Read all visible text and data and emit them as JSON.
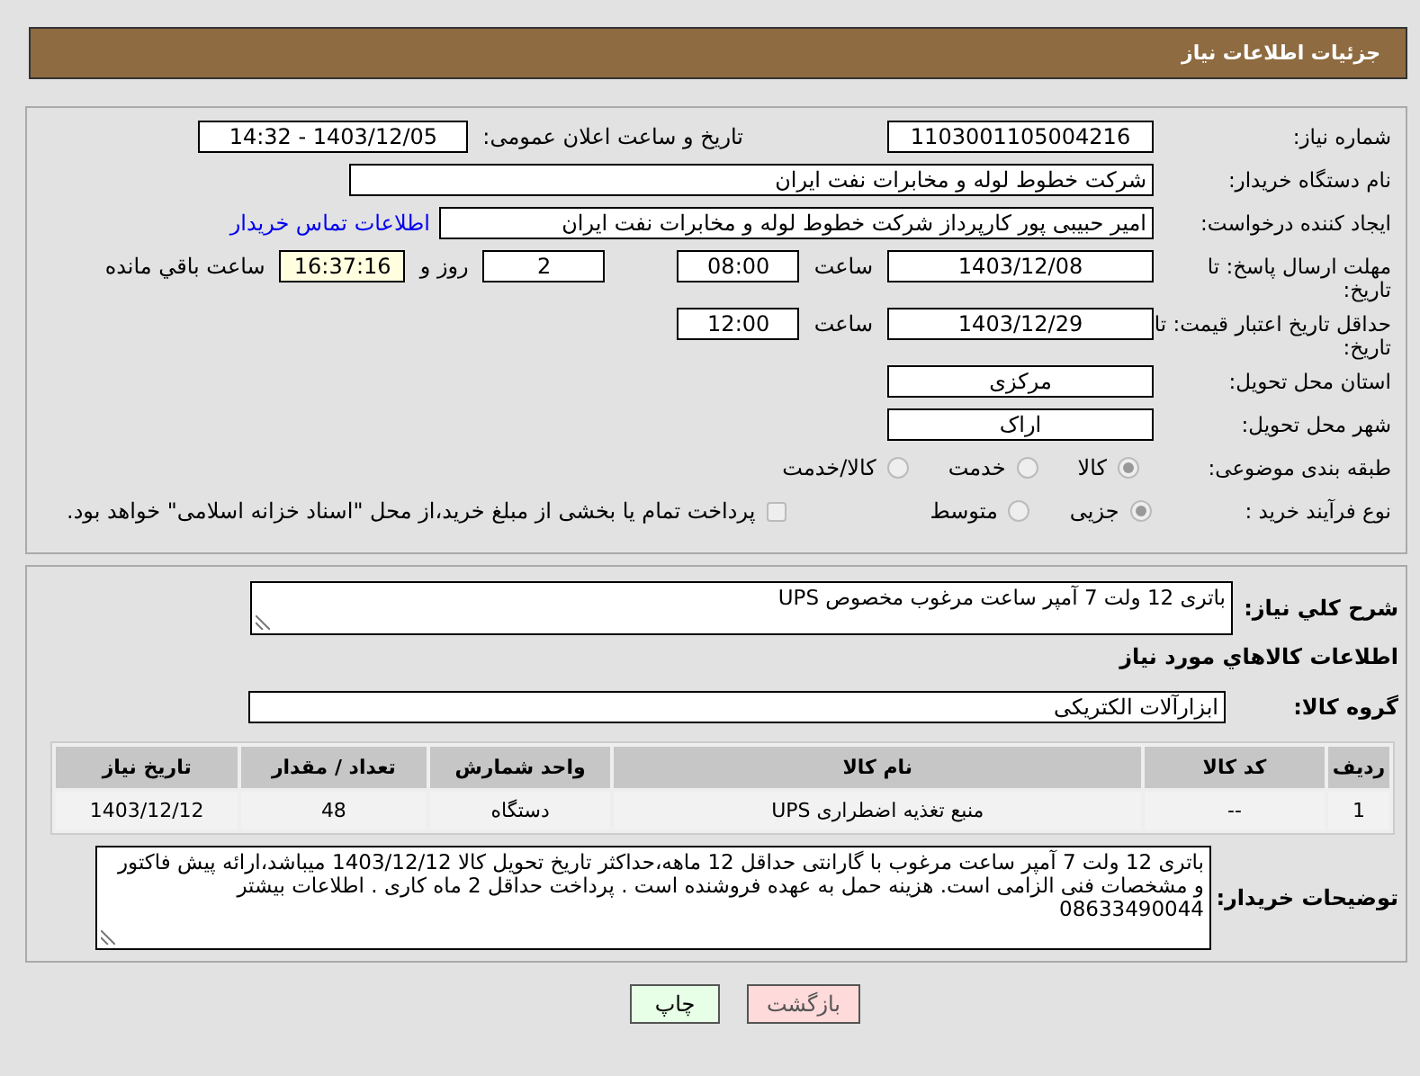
{
  "header": {
    "title": "جزئیات اطلاعات نیاز"
  },
  "details": [
    {
      "label": "شماره نیاز:",
      "parts": [
        {
          "kind": "field",
          "value": "1103001105004216"
        },
        {
          "kind": "text",
          "value": "تاریخ و ساعت اعلان عمومی:"
        },
        {
          "kind": "field",
          "value": "1403/12/05 - 14:32"
        }
      ]
    },
    {
      "label": "نام دستگاه خریدار:",
      "parts": [
        {
          "kind": "field",
          "value": "شرکت خطوط لوله و مخابرات نفت ایران"
        }
      ]
    },
    {
      "label": "ایجاد کننده درخواست:",
      "parts": [
        {
          "kind": "field",
          "value": "امیر  حبیبی پور  کارپرداز شرکت خطوط لوله و مخابرات نفت ایران"
        },
        {
          "kind": "link",
          "value": "اطلاعات تماس خریدار"
        }
      ]
    },
    {
      "label": "مهلت ارسال پاسخ: تا تاریخ:",
      "parts": [
        {
          "kind": "field",
          "value": "1403/12/08"
        },
        {
          "kind": "text",
          "value": "ساعت"
        },
        {
          "kind": "field",
          "value": "08:00"
        },
        {
          "kind": "field",
          "value": "2"
        },
        {
          "kind": "text",
          "value": "روز و"
        },
        {
          "kind": "timer",
          "value": "16:37:16"
        },
        {
          "kind": "text",
          "value": "ساعت باقي مانده"
        }
      ]
    },
    {
      "label": "حداقل تاریخ اعتبار قیمت: تا تاریخ:",
      "parts": [
        {
          "kind": "field",
          "value": "1403/12/29"
        },
        {
          "kind": "text",
          "value": "ساعت"
        },
        {
          "kind": "field",
          "value": "12:00"
        }
      ]
    },
    {
      "label": "استان محل تحویل:",
      "parts": [
        {
          "kind": "field",
          "value": "مرکزی"
        }
      ]
    },
    {
      "label": "شهر محل تحویل:",
      "parts": [
        {
          "kind": "field",
          "value": "اراک"
        }
      ]
    },
    {
      "label": "طبقه بندی موضوعی:",
      "parts": [
        {
          "kind": "radio",
          "value": "کالا",
          "selected": true
        },
        {
          "kind": "radio",
          "value": "خدمت",
          "selected": false
        },
        {
          "kind": "radio",
          "value": "کالا/خدمت",
          "selected": false
        }
      ]
    },
    {
      "label": "نوع فرآیند خرید :",
      "parts": [
        {
          "kind": "radio",
          "value": "جزیی",
          "selected": true
        },
        {
          "kind": "radio",
          "value": "متوسط",
          "selected": false
        },
        {
          "kind": "checkbox",
          "value": "پرداخت تمام یا بخشی از مبلغ خرید،از محل \"اسناد خزانه اسلامی\" خواهد بود.",
          "checked": false
        }
      ]
    }
  ],
  "needs": {
    "summary_label": "شرح کلي نياز:",
    "summary": "باتری 12 ولت 7 آمپر ساعت مرغوب مخصوص UPS",
    "goods_heading": "اطلاعات کالاهاي مورد نياز",
    "group_label": "گروه کالا:",
    "group": "ابزارآلات الکتریکی",
    "table": {
      "columns": [
        "ردیف",
        "کد کالا",
        "نام کالا",
        "واحد شمارش",
        "تعداد / مقدار",
        "تاریخ نیاز"
      ],
      "rows": [
        [
          "1",
          "--",
          "منبع تغذیه اضطراری UPS",
          "دستگاه",
          "48",
          "1403/12/12"
        ]
      ]
    },
    "notes_label": "توضیحات خریدار:",
    "notes": "باتری 12 ولت 7 آمپر ساعت مرغوب با گارانتی حداقل 12 ماهه،حداکثر تاریخ تحویل کالا 1403/12/12 میباشد،ارائه پیش فاکتور و مشخصات فنی الزامی است. هزینه حمل به عهده فروشنده است . پرداخت حداقل 2 ماه کاری . اطلاعات بیشتر 08633490044"
  },
  "buttons": [
    {
      "kind": "back",
      "label": "بازگشت"
    },
    {
      "kind": "print",
      "label": "چاپ"
    }
  ]
}
